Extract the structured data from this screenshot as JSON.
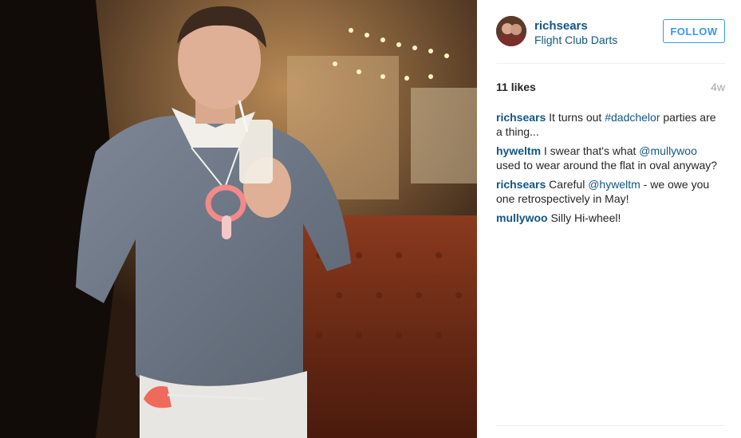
{
  "post": {
    "username": "richsears",
    "location": "Flight Club Darts",
    "follow_label": "FOLLOW",
    "likes": "11 likes",
    "age": "4w"
  },
  "comments": [
    {
      "user": "richsears",
      "parts": [
        "It turns out ",
        "#dadchelor",
        " parties are a thing..."
      ]
    },
    {
      "user": "hyweltm",
      "parts": [
        "I swear that's what ",
        "@mullywoo",
        " used to wear around the flat in oval anyway?"
      ]
    },
    {
      "user": "richsears",
      "parts": [
        "Careful ",
        "@hyweltm",
        " - we owe you one retrospectively in May!"
      ]
    },
    {
      "user": "mullywoo",
      "parts": [
        "Silly Hi-wheel!"
      ]
    }
  ],
  "colors": {
    "link": "#125688",
    "follow": "#3897f0",
    "muted": "#a5a7aa"
  },
  "icons": {
    "avatar": "profile-photo"
  }
}
